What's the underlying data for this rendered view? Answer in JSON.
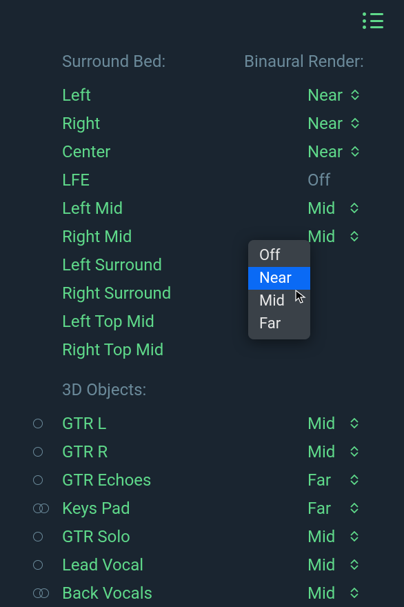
{
  "headers": {
    "left": "Surround Bed:",
    "right": "Binaural Render:"
  },
  "surroundBed": [
    {
      "name": "Left",
      "value": "Near",
      "chevron": true
    },
    {
      "name": "Right",
      "value": "Near",
      "chevron": true
    },
    {
      "name": "Center",
      "value": "Near",
      "chevron": true
    },
    {
      "name": "LFE",
      "value": "Off",
      "chevron": false,
      "off": true
    },
    {
      "name": "Left Mid",
      "value": "Mid",
      "chevron": true
    },
    {
      "name": "Right Mid",
      "value": "Mid",
      "chevron": true
    },
    {
      "name": "Left Surround",
      "value": "",
      "chevron": false
    },
    {
      "name": "Right Surround",
      "value": "",
      "chevron": false
    },
    {
      "name": "Left Top Mid",
      "value": "",
      "chevron": false
    },
    {
      "name": "Right Top Mid",
      "value": "",
      "chevron": false
    }
  ],
  "objectsHeader": "3D Objects:",
  "objects": [
    {
      "name": "GTR L",
      "value": "Mid",
      "icon": "single"
    },
    {
      "name": "GTR R",
      "value": "Mid",
      "icon": "single"
    },
    {
      "name": "GTR Echoes",
      "value": "Far",
      "icon": "single"
    },
    {
      "name": "Keys Pad",
      "value": "Far",
      "icon": "double"
    },
    {
      "name": "GTR Solo",
      "value": "Mid",
      "icon": "single"
    },
    {
      "name": "Lead Vocal",
      "value": "Mid",
      "icon": "single"
    },
    {
      "name": "Back Vocals",
      "value": "Mid",
      "icon": "double"
    }
  ],
  "popup": {
    "options": [
      "Off",
      "Near",
      "Mid",
      "Far"
    ],
    "selected": "Near"
  }
}
